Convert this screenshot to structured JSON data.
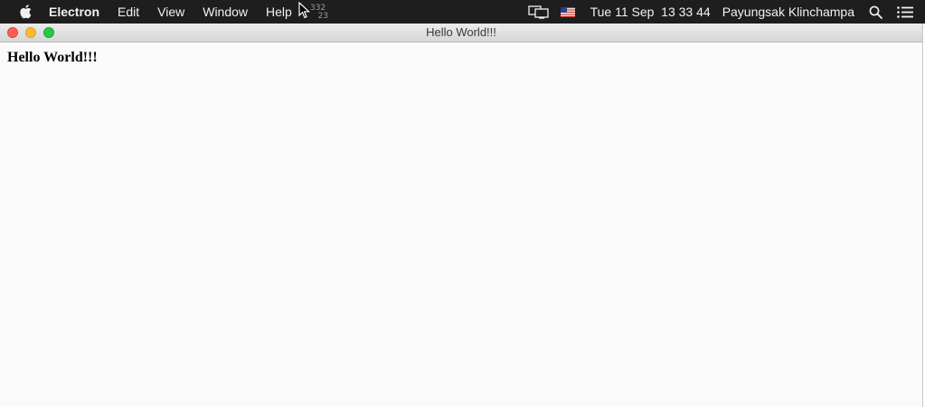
{
  "menubar": {
    "apple_icon": "apple-logo-icon",
    "app_name": "Electron",
    "items": [
      {
        "label": "Edit"
      },
      {
        "label": "View"
      },
      {
        "label": "Window"
      },
      {
        "label": "Help"
      }
    ],
    "cursor_label": "332\n23",
    "status": {
      "mirror_icon": "display-mirroring-icon",
      "input_icon": "us-flag-icon",
      "clock": "Tue 11 Sep  13 33 44",
      "user": "Payungsak Klinchampa",
      "spotlight_icon": "search-icon",
      "notification_icon": "list-icon"
    }
  },
  "window": {
    "title": "Hello World!!!",
    "controls": [
      "close",
      "minimize",
      "zoom"
    ],
    "content": {
      "heading": "Hello World!!!"
    }
  },
  "colors": {
    "menubar_bg": "#1e1e1e",
    "window_bg": "#fafafa",
    "close": "#fc5f57",
    "minimize": "#fdbc2e",
    "zoom": "#28c840"
  }
}
